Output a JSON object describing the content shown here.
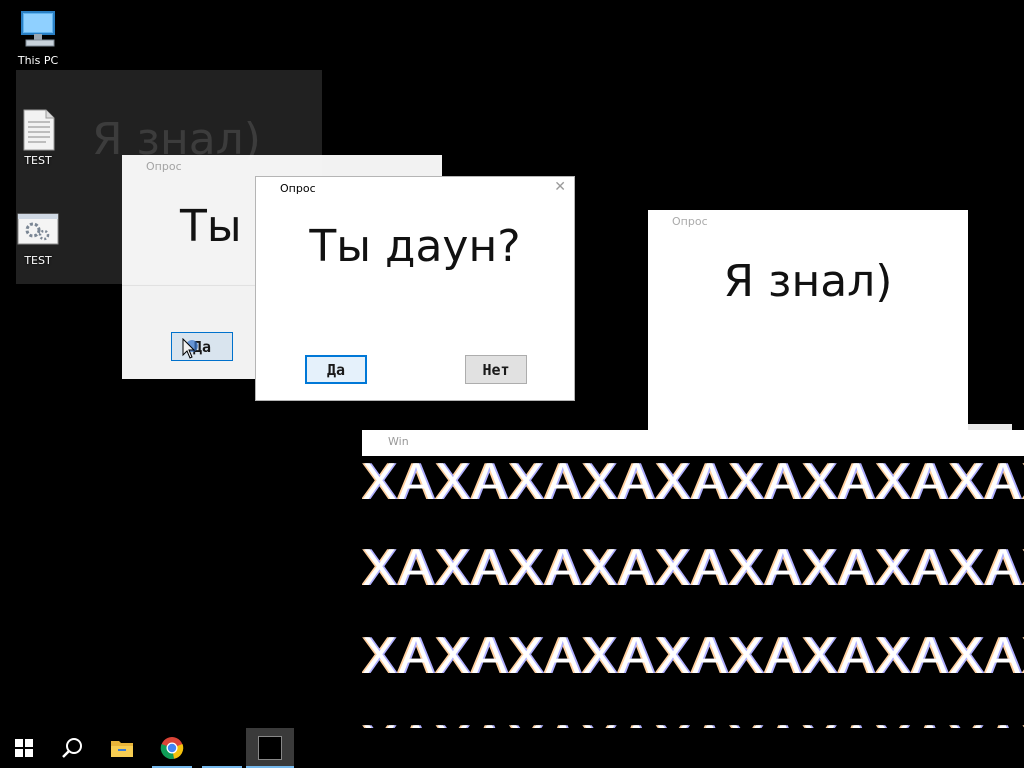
{
  "desktop": {
    "icons": [
      {
        "label": "This PC"
      },
      {
        "label": "TEST"
      },
      {
        "label": "TEST"
      }
    ],
    "ghost_text": "Я знал)"
  },
  "windows": {
    "back_dialog": {
      "title": "Опрос",
      "message": "Ты",
      "yes_label": "Да"
    },
    "front_dialog": {
      "title": "Опрос",
      "message": "Ты даун?",
      "yes_label": "Да",
      "no_label": "Нет",
      "close_glyph": "✕"
    },
    "right_dialog": {
      "title": "Опрос",
      "message": "Я знал)"
    },
    "laugh_window": {
      "title": "Win",
      "rows": [
        "XAXAXAXAXAXAXAXAXAXAXAXA",
        "XAXAXAXAXAXAXAXAXAXAXAXA",
        "XAXAXAXAXAXAXAXAXAXAXAXA",
        "XAXAXAXAXAXAXAXAXAXAXAXA"
      ]
    }
  },
  "taskbar": {
    "items": [
      {
        "icon": "windows-start-icon"
      },
      {
        "icon": "search-icon"
      },
      {
        "icon": "file-explorer-icon"
      },
      {
        "icon": "chrome-icon"
      },
      {
        "icon": "blank-app-icon"
      },
      {
        "icon": "black-window-icon"
      }
    ]
  },
  "colors": {
    "background": "#000000",
    "focus_accent": "#0078d7",
    "button_face": "#e1e1e1"
  }
}
